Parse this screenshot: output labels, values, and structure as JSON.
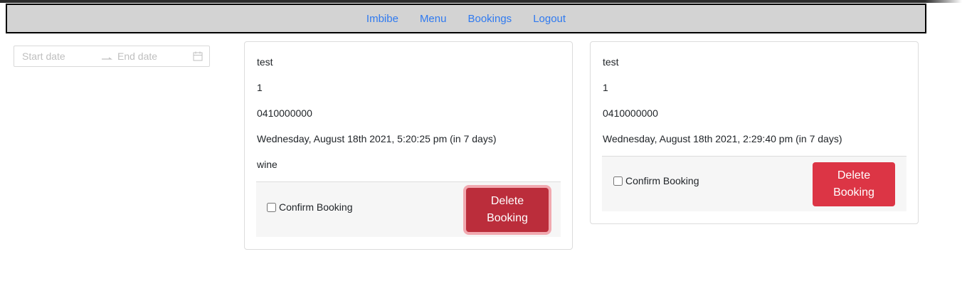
{
  "nav": {
    "links": [
      "Imbibe",
      "Menu",
      "Bookings",
      "Logout"
    ]
  },
  "filter": {
    "start_placeholder": "Start date",
    "end_placeholder": "End date",
    "icons": [
      "arrow-right-icon",
      "calendar-icon"
    ]
  },
  "bookings": [
    {
      "name": "test",
      "guests": "1",
      "phone": "0410000000",
      "datetime": "Wednesday, August 18th 2021, 5:20:25 pm (in 7 days)",
      "notes": "wine",
      "confirm_label": "Confirm Booking",
      "delete_label": "Delete Booking"
    },
    {
      "name": "test",
      "guests": "1",
      "phone": "0410000000",
      "datetime": "Wednesday, August 18th 2021, 2:29:40 pm (in 7 days)",
      "confirm_label": "Confirm Booking",
      "delete_label": "Delete Booking"
    }
  ],
  "colors": {
    "nav_bg": "#d3d3d3",
    "link": "#2f7af0",
    "danger": "#dc3545",
    "danger_active": "#bb2d3b"
  }
}
